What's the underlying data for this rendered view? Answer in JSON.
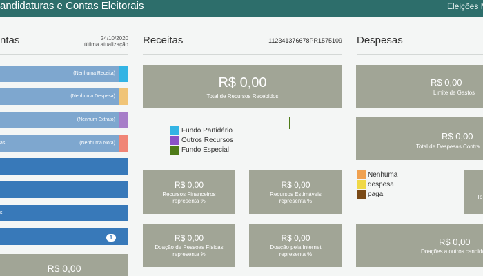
{
  "header": {
    "title": "andidaturas e Contas Eleitorais",
    "right": "Eleições M"
  },
  "left": {
    "title": "ntas",
    "date": "24/10/2020",
    "updated": "última atualização",
    "status_bars": [
      {
        "label": "(Nenhuma Receita)",
        "accent": "#33b4e4"
      },
      {
        "label": "(Nenhuma Despesa)",
        "accent": "#f0c477"
      },
      {
        "label": "(Nenhum Extrato)",
        "accent": "#a77ec8"
      },
      {
        "prefix": "as",
        "label": "(Nenhuma Nota)",
        "accent": "#f08576"
      }
    ],
    "extra_prefix": "s",
    "badge": "1",
    "bottom_card": {
      "value": "R$ 0,00"
    }
  },
  "receitas": {
    "title": "Receitas",
    "id": "112341376678PR1575109",
    "total": {
      "value": "R$ 0,00",
      "caption": "Total de Recursos Recebidos"
    },
    "legend": [
      {
        "label": "Fundo Partidário",
        "color": "#33b4e4"
      },
      {
        "label": "Outros Recursos",
        "color": "#8a52c7"
      },
      {
        "label": "Fundo Especial",
        "color": "#4e7b18"
      }
    ],
    "cards": [
      {
        "value": "R$ 0,00",
        "caption": "Recursos Financeiros",
        "sub": "representa %"
      },
      {
        "value": "R$ 0,00",
        "caption": "Recursos Estimáveis",
        "sub": "representa %"
      },
      {
        "value": "R$ 0,00",
        "caption": "Doação de Pessoas Físicas",
        "sub": "representa %"
      },
      {
        "value": "R$ 0,00",
        "caption": "Doação pela Internet",
        "sub": "representa %"
      }
    ]
  },
  "despesas": {
    "title": "Despesas",
    "limite": {
      "value": "R$ 0,00",
      "caption": "Limite de Gastos"
    },
    "total": {
      "value": "R$ 0,00",
      "caption": "Total de Despesas Contra"
    },
    "legend": [
      {
        "label": "Nenhuma",
        "color": "#f0a14f"
      },
      {
        "label": "despesa",
        "color": "#f0d847"
      },
      {
        "label": "paga",
        "color": "#7a4a16"
      }
    ],
    "side_card": {
      "caption": "To"
    },
    "doacoes": {
      "value": "R$ 0,00",
      "caption": "Doações a outros candidatos de"
    }
  }
}
